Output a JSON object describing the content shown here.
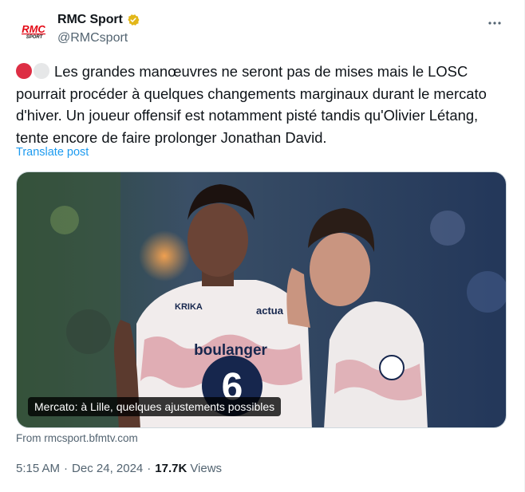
{
  "author": {
    "display_name": "RMC Sport",
    "handle": "@RMCsport",
    "logo_text_top": "RMC",
    "logo_text_bottom": "SPORT"
  },
  "post": {
    "text": "Les grandes manœuvres ne seront pas de mises mais le LOSC pourrait procéder à quelques changements marginaux durant le mercato d'hiver. Un joueur offensif est notamment pisté tandis qu'Olivier Létang, tente encore de faire prolonger Jonathan David.",
    "translate_label": "Translate post",
    "media_caption": "Mercato: à Lille, quelques ajustements possibles",
    "source": "From rmcsport.bfmtv.com",
    "time": "5:15 AM",
    "date": "Dec 24, 2024",
    "views_count": "17.7K",
    "views_label": "Views",
    "separator": "·"
  },
  "icons": {
    "verified": "verified-gold-badge-icon",
    "more": "more-horizontal-icon",
    "emoji_1": "red-circle-emoji",
    "emoji_2": "white-circle-emoji"
  },
  "jersey_texts": {
    "sponsor": "boulanger",
    "sleeve": "actua",
    "brand": "KRIKA",
    "number": "6"
  },
  "colors": {
    "text": "#0f1419",
    "muted": "#536471",
    "link": "#1d9bf0",
    "badge": "#e2b719",
    "logo_red": "#e30613"
  }
}
